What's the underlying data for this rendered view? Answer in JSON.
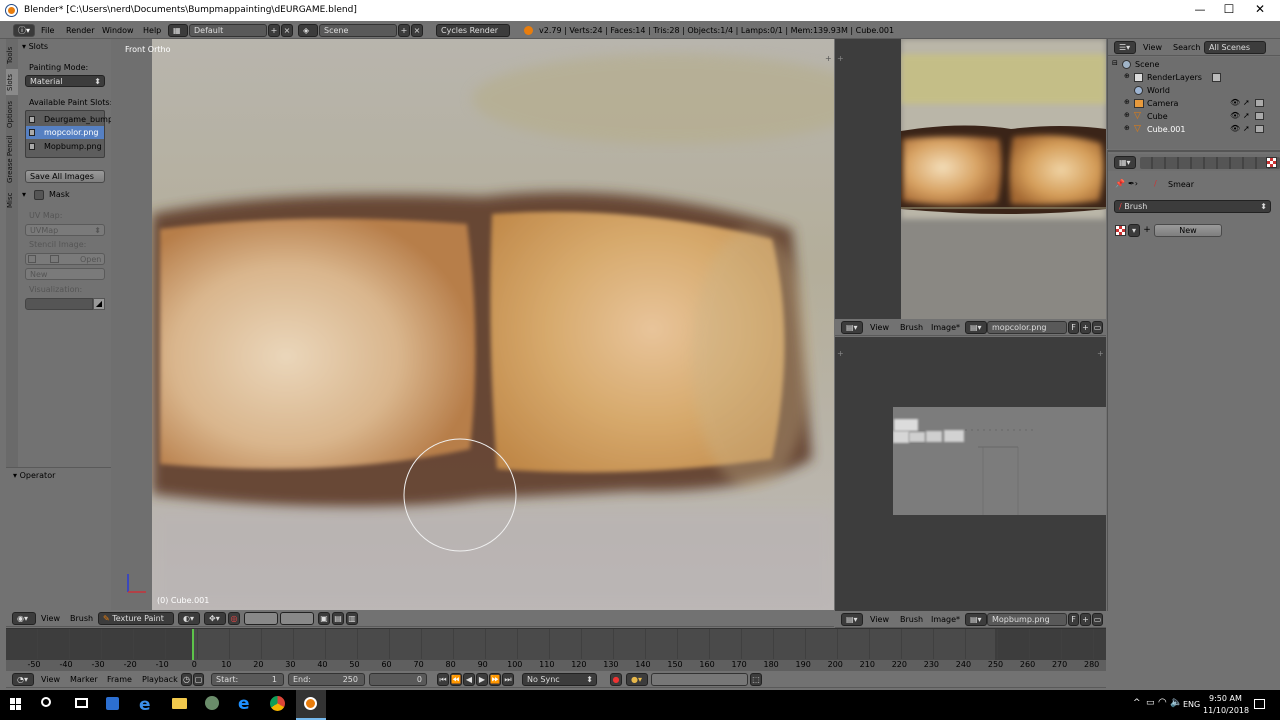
{
  "window": {
    "title": "Blender* [C:\\Users\\nerd\\Documents\\Bumpmappainting\\dEURGAME.blend]",
    "controls": [
      "—",
      "☐",
      "✕"
    ]
  },
  "info_header": {
    "menus": [
      "File",
      "Render",
      "Window",
      "Help"
    ],
    "layout": "Default",
    "scene": "Scene",
    "engine": "Cycles Render",
    "stats": "v2.79 | Verts:24 | Faces:14 | Tris:28 | Objects:1/4 | Lamps:0/1 | Mem:139.93M | Cube.001"
  },
  "tool_tabs": [
    "Tools",
    "Slots",
    "Options",
    "Grease Pencil",
    "Misc"
  ],
  "slots_panel": {
    "header": "Slots",
    "painting_mode_label": "Painting Mode:",
    "painting_mode": "Material",
    "available_label": "Available Paint Slots:",
    "slots": [
      "Deurgame_bump",
      "mopcolor.png",
      "Mopbump.png"
    ],
    "selected_index": 1,
    "save_all": "Save All Images",
    "mask_header": "Mask",
    "uvmap_label": "UV Map:",
    "uvmap": "UVMap",
    "stencil_label": "Stencil Image:",
    "open": "Open",
    "new": "New",
    "visualization_label": "Visualization:"
  },
  "operator_panel": {
    "header": "Operator"
  },
  "viewport": {
    "label": "Front Ortho",
    "object_label": "(0) Cube.001",
    "header": {
      "view": "View",
      "brush": "Brush",
      "mode": "Texture Paint"
    }
  },
  "image_editor_top": {
    "menus": [
      "View",
      "Brush",
      "Image*"
    ],
    "image": "mopcolor.png",
    "f": "F"
  },
  "image_editor_bottom": {
    "menus": [
      "View",
      "Brush",
      "Image*"
    ],
    "image": "Mopbump.png",
    "f": "F"
  },
  "outliner": {
    "menus": [
      "View",
      "Search"
    ],
    "filter": "All Scenes",
    "items": [
      {
        "label": "Scene",
        "indent": 0
      },
      {
        "label": "RenderLayers",
        "indent": 1
      },
      {
        "label": "World",
        "indent": 1
      },
      {
        "label": "Camera",
        "indent": 1
      },
      {
        "label": "Cube",
        "indent": 1
      },
      {
        "label": "Cube.001",
        "indent": 1
      }
    ]
  },
  "properties": {
    "smear": "Smear",
    "brush_panel": "Brush",
    "new": "New"
  },
  "timeline": {
    "ticks": [
      "-50",
      "-40",
      "-30",
      "-20",
      "-10",
      "0",
      "10",
      "20",
      "30",
      "40",
      "50",
      "60",
      "70",
      "80",
      "90",
      "100",
      "110",
      "120",
      "130",
      "140",
      "150",
      "160",
      "170",
      "180",
      "190",
      "200",
      "210",
      "220",
      "230",
      "240",
      "250",
      "260",
      "270",
      "280"
    ],
    "menus": [
      "View",
      "Marker",
      "Frame",
      "Playback"
    ],
    "start": "Start:",
    "start_val": "1",
    "end": "End:",
    "end_val": "250",
    "current": "0",
    "sync": "No Sync"
  },
  "taskbar": {
    "lang": "ENG",
    "time": "9:50 AM",
    "date": "11/10/2018"
  }
}
